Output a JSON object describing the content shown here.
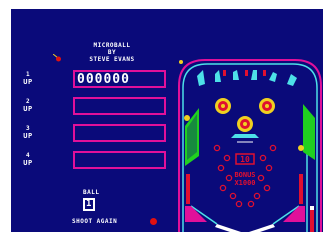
{
  "title": {
    "line1": "MICROBALL",
    "line2": "BY",
    "line3": "STEVE EVANS"
  },
  "players": [
    {
      "number": "1",
      "up": "UP",
      "score": "000000"
    },
    {
      "number": "2",
      "up": "UP",
      "score": ""
    },
    {
      "number": "3",
      "up": "UP",
      "score": ""
    },
    {
      "number": "4",
      "up": "UP",
      "score": ""
    }
  ],
  "ball": {
    "label": "BALL",
    "value": "1"
  },
  "shoot_again": {
    "label": "SHOOT AGAIN"
  },
  "table": {
    "center_target": "10",
    "bonus_label": "BONUS",
    "bonus_value": "X1000"
  },
  "colors": {
    "background": "#0a0a7a",
    "score_box_border": "#e0109a",
    "table_border_outer": "#e0109a",
    "table_border_inner": "#4de0e8",
    "target_red": "#e01030",
    "bumper_yellow": "#f0d020",
    "ramp_green": "#20d020",
    "text": "#ffffff"
  },
  "icons": {
    "logo": "pinball-icon",
    "shoot_again_light": "shoot-again-light-icon"
  }
}
